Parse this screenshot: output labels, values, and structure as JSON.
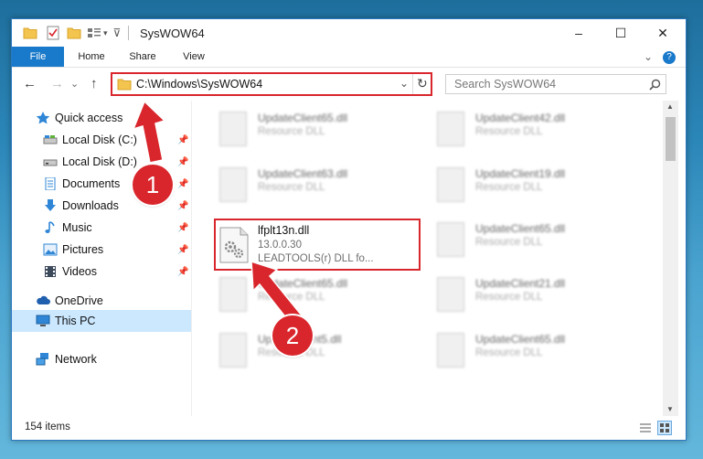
{
  "window": {
    "title": "SysWOW64",
    "controls": {
      "minimize": "–",
      "maximize": "☐",
      "close": "✕"
    }
  },
  "ribbon": {
    "tabs": [
      {
        "label": "File"
      },
      {
        "label": "Home"
      },
      {
        "label": "Share"
      },
      {
        "label": "View"
      }
    ],
    "expand": "⌄",
    "help": "?"
  },
  "navigation": {
    "back": "←",
    "forward": "→",
    "recent": "⌄",
    "up": "↑",
    "address": "C:\\Windows\\SysWOW64",
    "address_dropdown": "⌄",
    "refresh": "↻",
    "search_placeholder": "Search SysWOW64"
  },
  "sidebar": {
    "items": [
      {
        "label": "Quick access",
        "icon": "star-icon"
      },
      {
        "label": "Local Disk (C:)",
        "icon": "drive-icon",
        "pinned": true
      },
      {
        "label": "Local Disk (D:)",
        "icon": "drive-icon",
        "pinned": true
      },
      {
        "label": "Documents",
        "icon": "document-icon",
        "pinned": true
      },
      {
        "label": "Downloads",
        "icon": "download-icon",
        "pinned": true
      },
      {
        "label": "Music",
        "icon": "music-icon",
        "pinned": true
      },
      {
        "label": "Pictures",
        "icon": "picture-icon",
        "pinned": true
      },
      {
        "label": "Videos",
        "icon": "video-icon",
        "pinned": true
      },
      {
        "label": "OneDrive",
        "icon": "cloud-icon"
      },
      {
        "label": "This PC",
        "icon": "computer-icon",
        "selected": true
      },
      {
        "label": "Network",
        "icon": "network-icon"
      }
    ],
    "pin_glyph": "📌"
  },
  "files": {
    "selected": {
      "name": "lfplt13n.dll",
      "version": "13.0.0.30",
      "description": "LEADTOOLS(r) DLL fo..."
    },
    "left_column": [
      {
        "name": "UpdateClient65.dll",
        "desc": "Resource DLL"
      },
      {
        "name": "UpdateClient63.dll",
        "desc": "Resource DLL"
      },
      {
        "name": "UpdateClient65.dll",
        "desc": "Resource DLL"
      },
      {
        "name": "UpdateClient5.dll",
        "desc": "Resource DLL"
      }
    ],
    "right_column": [
      {
        "name": "UpdateClient42.dll",
        "desc": "Resource DLL"
      },
      {
        "name": "UpdateClient19.dll",
        "desc": "Resource DLL"
      },
      {
        "name": "UpdateClient65.dll",
        "desc": "Resource DLL"
      },
      {
        "name": "UpdateClient21.dll",
        "desc": "Resource DLL"
      },
      {
        "name": "UpdateClient65.dll",
        "desc": "Resource DLL"
      }
    ]
  },
  "status": {
    "item_count": "154 items"
  },
  "annotations": {
    "step1": "1",
    "step2": "2",
    "color": "#d9262c"
  }
}
